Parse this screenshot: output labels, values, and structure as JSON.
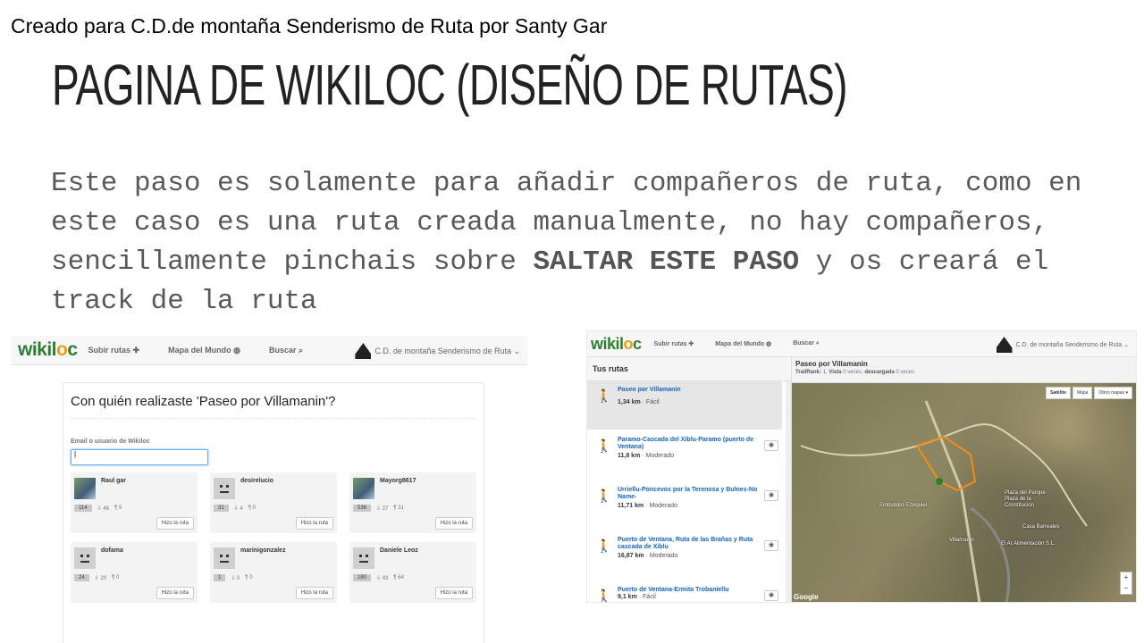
{
  "slide": {
    "credit": "Creado para C.D.de montaña Senderismo de Ruta por Santy Gar",
    "title": "PAGINA DE WIKILOC (DISEÑO DE RUTAS)",
    "body_part1": "Este paso es solamente para añadir compañeros de ruta, como en este caso es una ruta creada manualmente, no hay compañeros, sencillamente pinchais sobre ",
    "body_bold": "SALTAR ESTE PASO",
    "body_part2": " y os creará el track de la ruta"
  },
  "shot1": {
    "logo_a": "wikil",
    "logo_o": "o",
    "logo_b": "c",
    "nav_upload": "Subir rutas ✚",
    "nav_world": "Mapa del Mundo ◍",
    "nav_search": "Buscar ⌕",
    "nav_user": "C.D. de montaña Senderismo de Ruta ⌄",
    "modal_title": "Con quién realizaste 'Paseo por Villamanin'?",
    "email_label": "Email o usuario de Wikiloc",
    "email_value": "|",
    "done_label": "Hizo la ruta",
    "users": [
      {
        "name": "Raul gar",
        "count": "114",
        "followers": "46",
        "following": "9"
      },
      {
        "name": "desirelucio",
        "count": "31",
        "followers": "4",
        "following": "0"
      },
      {
        "name": "Mayorg8617",
        "count": "536",
        "followers": "27",
        "following": "31"
      },
      {
        "name": "dofama",
        "count": "24",
        "followers": "20",
        "following": "0"
      },
      {
        "name": "marinigonzalez",
        "count": "1",
        "followers": "0",
        "following": "0"
      },
      {
        "name": "Daniele Leoz",
        "count": "180",
        "followers": "43",
        "following": "64"
      }
    ]
  },
  "shot2": {
    "logo_a": "wikil",
    "logo_o": "o",
    "logo_b": "c",
    "nav_upload": "Subir rutas ✚",
    "nav_world": "Mapa del Mundo ◍",
    "nav_search": "Buscar ⌕",
    "nav_user": "C.D. de montaña Senderismo de Ruta ⌄",
    "sidebar_title": "Tus rutas",
    "routes": [
      {
        "name": "Paseo por Villamanin",
        "dist": "1,34 km",
        "level": "Fácil"
      },
      {
        "name": "Paramo-Cascada del Xiblu-Paramo (puerto de Ventana)",
        "dist": "11,8 km",
        "level": "Moderado"
      },
      {
        "name": "Urriellu-Poncevos por la Terenosa y Bulnes-No Name-",
        "dist": "11,71 km",
        "level": "Moderado"
      },
      {
        "name": "Puerto de Ventana, Ruta de las Brañas y Ruta cascada de Xiblu",
        "dist": "16,87 km",
        "level": "Moderado"
      },
      {
        "name": "Puerto de Ventana-Ermita Trobaniellu",
        "dist": "9,1 km",
        "level": "Fácil"
      }
    ],
    "map_title": "Paseo por Villamanin",
    "map_trailrank_label": "TrailRank:",
    "map_trailrank": "1",
    "map_views_label": "Vista",
    "map_views": "0 veces,",
    "map_downloads_label": "descargada",
    "map_downloads": "0 veces",
    "map_btn_satellite": "Satélite",
    "map_btn_map": "Mapa",
    "map_btn_other": "Otros mapas ▾",
    "map_labels": [
      "Embutidos Ezequiel",
      "Plaza del Parque Plaza de la Constitucion",
      "Casa Barreales",
      "El Ar Alimentación S.L.",
      "Villamanin"
    ],
    "google": "Google"
  }
}
